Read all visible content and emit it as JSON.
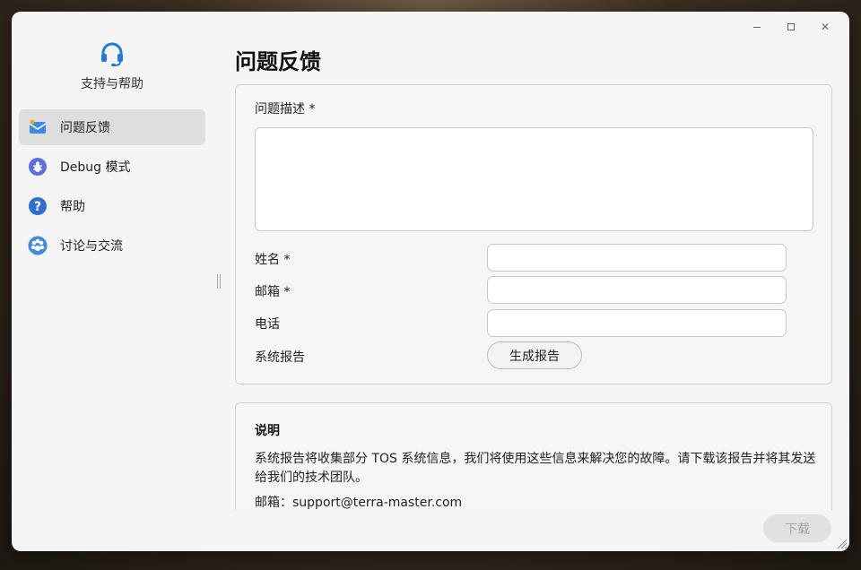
{
  "window": {
    "controls": {
      "minimize": "—",
      "maximize": "□",
      "close": "✕"
    }
  },
  "sidebar": {
    "app_title": "支持与帮助",
    "logo_icon": "headset-icon",
    "items": [
      {
        "label": "问题反馈",
        "icon": "mail-icon",
        "active": true
      },
      {
        "label": "Debug 模式",
        "icon": "bug-icon",
        "active": false
      },
      {
        "label": "帮助",
        "icon": "question-icon",
        "active": false
      },
      {
        "label": "讨论与交流",
        "icon": "community-icon",
        "active": false
      }
    ]
  },
  "main": {
    "title": "问题反馈",
    "form": {
      "description_label": "问题描述 *",
      "description_value": "",
      "name_label": "姓名 *",
      "name_value": "",
      "email_label": "邮箱 *",
      "email_value": "",
      "phone_label": "电话",
      "phone_value": "",
      "report_label": "系统报告",
      "generate_button": "生成报告"
    },
    "info": {
      "title": "说明",
      "body": "系统报告将收集部分 TOS 系统信息，我们将使用这些信息来解决您的故障。请下载该报告并将其发送给我们的技术团队。",
      "email": "邮箱：support@terra-master.com"
    },
    "download_button": "下载"
  },
  "colors": {
    "accent": "#1c7ce0",
    "active_item_bg": "#dedede",
    "disabled_text": "#a4a4a4"
  }
}
